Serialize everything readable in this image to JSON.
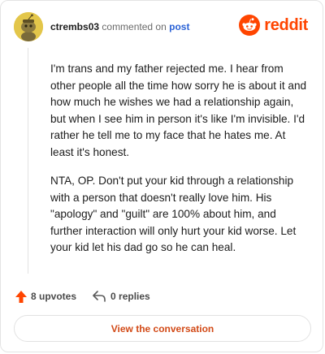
{
  "comment": {
    "username": "ctrembs03",
    "action_text": "commented on",
    "post_link": "post",
    "paragraphs": [
      "I'm trans and my father rejected me. I hear from other people all the time how sorry he is about it and how much he wishes we had a relationship again, but when I see him in person it's like I'm invisible. I'd rather he tell me to my face that he hates me. At least it's honest.",
      "NTA, OP. Don't put your kid through a relationship with a person that doesn't really love him. His \"apology\" and \"guilt\" are 100% about him, and further interaction will only hurt your kid worse. Let your kid let his dad go so he can heal."
    ]
  },
  "brand": {
    "name": "reddit",
    "color": "#ff4500"
  },
  "stats": {
    "upvotes": "8 upvotes",
    "replies": "0 replies"
  },
  "cta": {
    "label": "View the conversation"
  },
  "icons": {
    "avatar": "snoo-avatar-icon",
    "brand": "reddit-logo-icon",
    "upvote": "upvote-arrow-icon",
    "reply": "reply-arrow-icon"
  },
  "colors": {
    "accent": "#ff4500",
    "link": "#2a62d6",
    "cta_text": "#d24a17"
  }
}
